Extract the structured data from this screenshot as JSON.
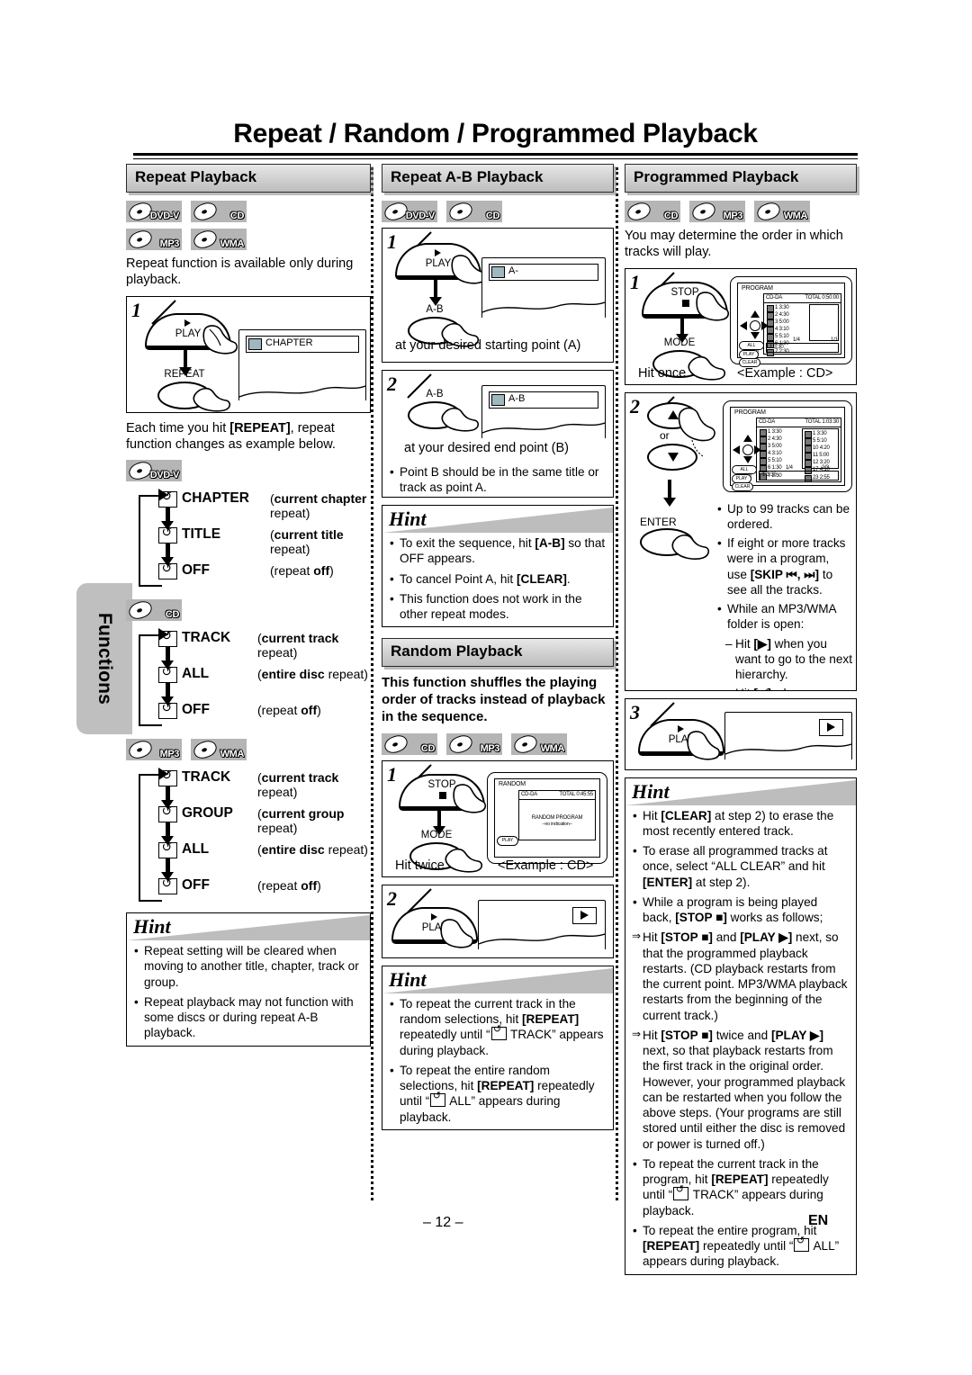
{
  "page": {
    "title": "Repeat / Random / Programmed Playback",
    "side_tab": "Functions",
    "page_number": "– 12 –",
    "language_mark": "EN"
  },
  "repeat_playback": {
    "heading": "Repeat Playback",
    "badges": [
      "DVD-V",
      "CD",
      "MP3",
      "WMA"
    ],
    "intro": "Repeat function is available only during playback.",
    "step1": {
      "number": "1",
      "button_play": "PLAY",
      "button_repeat": "REPEAT",
      "osd_text": "CHAPTER"
    },
    "after_step": "Each time you hit [REPEAT], repeat function changes as example below.",
    "cycles": [
      {
        "badges": [
          "DVD-V"
        ],
        "items": [
          {
            "name": "CHAPTER",
            "desc_bold": "current chapter",
            "desc_tail": " repeat)",
            "desc_head": "("
          },
          {
            "name": "TITLE",
            "desc_bold": "current title",
            "desc_tail": " repeat)",
            "desc_head": "("
          },
          {
            "name": "OFF",
            "desc_bold": "off",
            "desc_tail": ")",
            "desc_head": "(repeat "
          }
        ]
      },
      {
        "badges": [
          "CD"
        ],
        "items": [
          {
            "name": "TRACK",
            "desc_bold": "current track",
            "desc_tail": " repeat)",
            "desc_head": "("
          },
          {
            "name": "ALL",
            "desc_bold": "entire disc",
            "desc_tail": " repeat)",
            "desc_head": "("
          },
          {
            "name": "OFF",
            "desc_bold": "off",
            "desc_tail": ")",
            "desc_head": "(repeat "
          }
        ]
      },
      {
        "badges": [
          "MP3",
          "WMA"
        ],
        "items": [
          {
            "name": "TRACK",
            "desc_bold": "current track",
            "desc_tail": " repeat)",
            "desc_head": "("
          },
          {
            "name": "GROUP",
            "desc_bold": "current group",
            "desc_tail": " repeat)",
            "desc_head": "("
          },
          {
            "name": "ALL",
            "desc_bold": "entire disc",
            "desc_tail": " repeat)",
            "desc_head": "("
          },
          {
            "name": "OFF",
            "desc_bold": "off",
            "desc_tail": ")",
            "desc_head": "(repeat "
          }
        ]
      }
    ],
    "hint": {
      "label": "Hint",
      "items": [
        "Repeat setting will be cleared when moving to another title, chapter, track or group.",
        "Repeat playback may not function with some discs or during repeat A-B playback."
      ]
    }
  },
  "repeat_ab": {
    "heading": "Repeat A-B Playback",
    "badges": [
      "DVD-V",
      "CD"
    ],
    "step1": {
      "number": "1",
      "button_play": "PLAY",
      "button_ab": "A-B",
      "osd_text": "A-",
      "caption": "at your desired starting point (A)"
    },
    "step2": {
      "number": "2",
      "button_ab": "A-B",
      "osd_text": "A-B",
      "caption": "at your desired end point (B)",
      "note": "Point B should be in the same title or track as point A."
    },
    "hint": {
      "label": "Hint",
      "items": [
        "To exit the sequence, hit [A-B] so that OFF appears.",
        "To cancel Point A, hit [CLEAR].",
        "This function does not work in the other repeat modes."
      ]
    }
  },
  "random_playback": {
    "heading": "Random Playback",
    "intro": "This function shuffles the playing order of tracks instead of playback in the sequence.",
    "badges": [
      "CD",
      "MP3",
      "WMA"
    ],
    "step1": {
      "number": "1",
      "button_stop": "STOP",
      "button_mode": "MODE",
      "caption": "Hit twice.",
      "example": "<Example : CD>",
      "screen": {
        "mode_label": "RANDOM",
        "disc_type": "CD-DA",
        "total": "TOTAL 0:45:55",
        "center_line1": "RANDOM PROGRAM",
        "center_line2": "--no indication--",
        "play_tag": "PLAY"
      }
    },
    "step2": {
      "number": "2",
      "button_play": "PLAY"
    },
    "hint": {
      "label": "Hint",
      "items": [
        {
          "head": "To repeat the current track in the random selections, hit ",
          "bold": "[REPEAT]",
          "mid": " repeatedly until “",
          "icon": true,
          "tail": " TRACK” appears during playback."
        },
        {
          "head": "To repeat the entire random selections, hit ",
          "bold": "[REPEAT]",
          "mid": " repeatedly until “",
          "icon": true,
          "tail": " ALL” appears during playback."
        }
      ]
    }
  },
  "programmed_playback": {
    "heading": "Programmed Playback",
    "badges": [
      "CD",
      "MP3",
      "WMA"
    ],
    "intro": "You may determine the order in which tracks will play.",
    "step1": {
      "number": "1",
      "button_stop": "STOP",
      "button_mode": "MODE",
      "caption": "Hit once.",
      "example": "<Example : CD>",
      "screen": {
        "mode_label": "PROGRAM",
        "disc_type": "CD-DA",
        "total": "TOTAL 0:50:00",
        "tracks": [
          "1  3:30",
          "2  4:30",
          "3  5:00",
          "4  3:10",
          "5  5:10",
          "6  1:30",
          "7  2:30"
        ],
        "page_left": "1/4",
        "page_right": "1/1",
        "status": "1   3:30",
        "pad_labels": [
          "ALL CLEAR",
          "PLAY",
          "CLEAR"
        ]
      }
    },
    "step2": {
      "number": "2",
      "or_label": "or",
      "button_enter": "ENTER",
      "screen": {
        "mode_label": "PROGRAM",
        "disc_type": "CD-DA",
        "total": "TOTAL 1:03:30",
        "tracks": [
          "1  3:30",
          "2  4:30",
          "3  5:00",
          "4  3:10",
          "5  5:10",
          "6  1:30",
          "7  2:30"
        ],
        "program_tracks": [
          "1   3:30",
          "5   5:10",
          "10  4:20",
          "11  5:00",
          "12  3:20",
          "17  4:10",
          "23  2:55"
        ],
        "page_left": "1/4",
        "page_right": "2/3",
        "status": "1   3:30"
      },
      "notes": [
        {
          "text": "Up to 99 tracks can be ordered.",
          "type": "bullet"
        },
        {
          "text": "If eight or more tracks were in a program, use [SKIP ⏮, ⏭] to see all the tracks.",
          "type": "bullet"
        },
        {
          "text": "While an MP3/WMA folder is open:",
          "type": "bullet"
        },
        {
          "text": "Hit [▶] when you want to go to the next hierarchy.",
          "type": "dash"
        },
        {
          "text": "Hit [◀] when you want to go back to the previous hierarchy (except for the top hierarchy).",
          "type": "dash"
        }
      ]
    },
    "step3": {
      "number": "3",
      "button_play": "PLAY"
    },
    "hint": {
      "label": "Hint",
      "items": [
        {
          "kind": "bullet",
          "text": "Hit [CLEAR] at step 2) to erase the most recently entered track."
        },
        {
          "kind": "bullet",
          "text": "To erase all programmed tracks at once, select “ALL CLEAR” and hit [ENTER] at step 2)."
        },
        {
          "kind": "bullet",
          "text": "While a program is being played back, [STOP ■] works as follows;"
        },
        {
          "kind": "arrow",
          "text": "Hit [STOP ■] and [PLAY ▶] next, so that the programmed playback restarts. (CD playback restarts from the current point. MP3/WMA playback restarts from the beginning of the current track.)"
        },
        {
          "kind": "arrow",
          "text": "Hit [STOP ■] twice and [PLAY ▶] next, so that playback restarts from the first track in the original order. However, your programmed playback can be restarted when you follow the above steps. (Your programs are still stored until either the disc is removed or power is turned off.)"
        },
        {
          "kind": "bullet-icon",
          "head": "To repeat the current track in the program, hit ",
          "bold": "[REPEAT]",
          "mid": " repeatedly until “",
          "tail": " TRACK” appears during playback."
        },
        {
          "kind": "bullet-icon",
          "head": "To repeat the entire program, hit ",
          "bold": "[REPEAT]",
          "mid": " repeatedly until “",
          "tail": " ALL” appears during playback."
        }
      ]
    }
  }
}
